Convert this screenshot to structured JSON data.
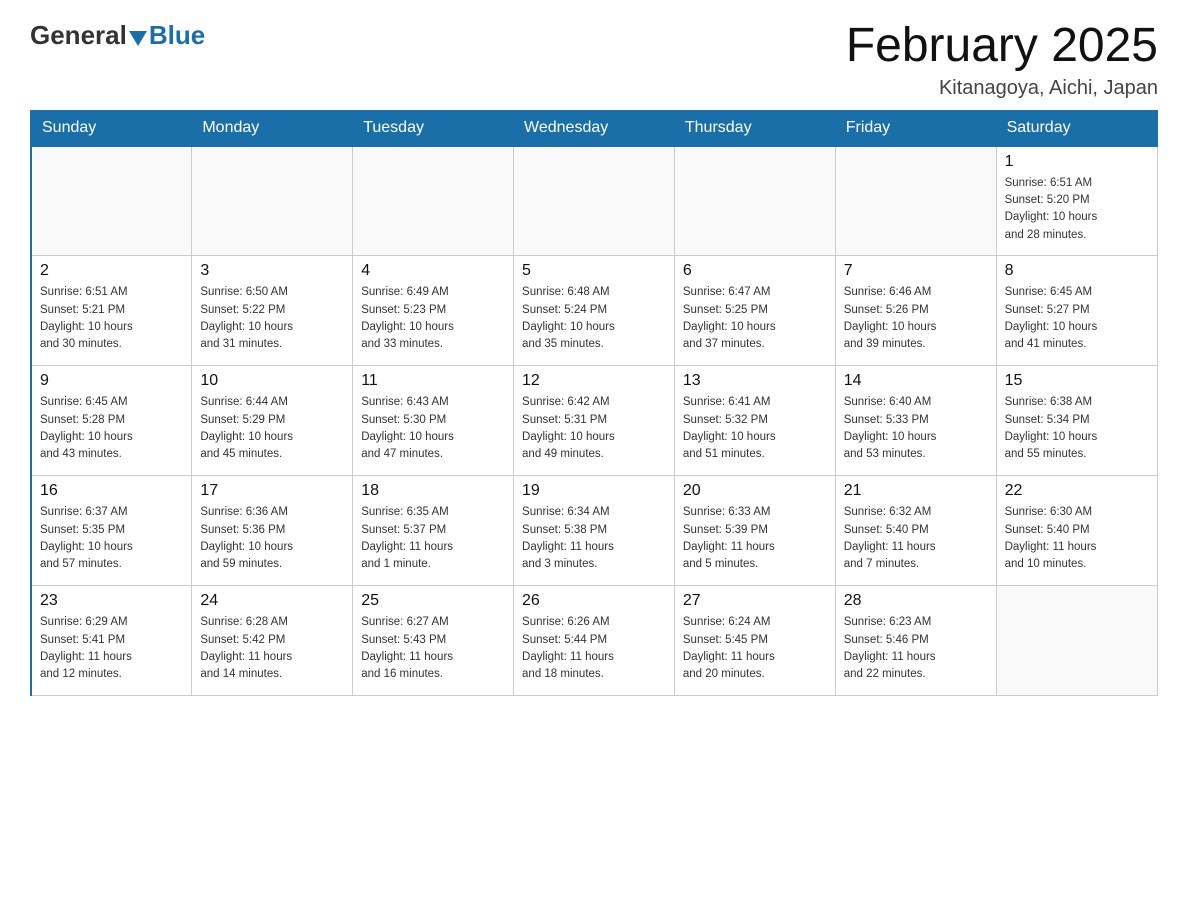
{
  "header": {
    "logo": {
      "general": "General",
      "blue": "Blue"
    },
    "title": "February 2025",
    "location": "Kitanagoya, Aichi, Japan"
  },
  "days_of_week": [
    "Sunday",
    "Monday",
    "Tuesday",
    "Wednesday",
    "Thursday",
    "Friday",
    "Saturday"
  ],
  "weeks": [
    [
      {
        "day": "",
        "info": ""
      },
      {
        "day": "",
        "info": ""
      },
      {
        "day": "",
        "info": ""
      },
      {
        "day": "",
        "info": ""
      },
      {
        "day": "",
        "info": ""
      },
      {
        "day": "",
        "info": ""
      },
      {
        "day": "1",
        "info": "Sunrise: 6:51 AM\nSunset: 5:20 PM\nDaylight: 10 hours\nand 28 minutes."
      }
    ],
    [
      {
        "day": "2",
        "info": "Sunrise: 6:51 AM\nSunset: 5:21 PM\nDaylight: 10 hours\nand 30 minutes."
      },
      {
        "day": "3",
        "info": "Sunrise: 6:50 AM\nSunset: 5:22 PM\nDaylight: 10 hours\nand 31 minutes."
      },
      {
        "day": "4",
        "info": "Sunrise: 6:49 AM\nSunset: 5:23 PM\nDaylight: 10 hours\nand 33 minutes."
      },
      {
        "day": "5",
        "info": "Sunrise: 6:48 AM\nSunset: 5:24 PM\nDaylight: 10 hours\nand 35 minutes."
      },
      {
        "day": "6",
        "info": "Sunrise: 6:47 AM\nSunset: 5:25 PM\nDaylight: 10 hours\nand 37 minutes."
      },
      {
        "day": "7",
        "info": "Sunrise: 6:46 AM\nSunset: 5:26 PM\nDaylight: 10 hours\nand 39 minutes."
      },
      {
        "day": "8",
        "info": "Sunrise: 6:45 AM\nSunset: 5:27 PM\nDaylight: 10 hours\nand 41 minutes."
      }
    ],
    [
      {
        "day": "9",
        "info": "Sunrise: 6:45 AM\nSunset: 5:28 PM\nDaylight: 10 hours\nand 43 minutes."
      },
      {
        "day": "10",
        "info": "Sunrise: 6:44 AM\nSunset: 5:29 PM\nDaylight: 10 hours\nand 45 minutes."
      },
      {
        "day": "11",
        "info": "Sunrise: 6:43 AM\nSunset: 5:30 PM\nDaylight: 10 hours\nand 47 minutes."
      },
      {
        "day": "12",
        "info": "Sunrise: 6:42 AM\nSunset: 5:31 PM\nDaylight: 10 hours\nand 49 minutes."
      },
      {
        "day": "13",
        "info": "Sunrise: 6:41 AM\nSunset: 5:32 PM\nDaylight: 10 hours\nand 51 minutes."
      },
      {
        "day": "14",
        "info": "Sunrise: 6:40 AM\nSunset: 5:33 PM\nDaylight: 10 hours\nand 53 minutes."
      },
      {
        "day": "15",
        "info": "Sunrise: 6:38 AM\nSunset: 5:34 PM\nDaylight: 10 hours\nand 55 minutes."
      }
    ],
    [
      {
        "day": "16",
        "info": "Sunrise: 6:37 AM\nSunset: 5:35 PM\nDaylight: 10 hours\nand 57 minutes."
      },
      {
        "day": "17",
        "info": "Sunrise: 6:36 AM\nSunset: 5:36 PM\nDaylight: 10 hours\nand 59 minutes."
      },
      {
        "day": "18",
        "info": "Sunrise: 6:35 AM\nSunset: 5:37 PM\nDaylight: 11 hours\nand 1 minute."
      },
      {
        "day": "19",
        "info": "Sunrise: 6:34 AM\nSunset: 5:38 PM\nDaylight: 11 hours\nand 3 minutes."
      },
      {
        "day": "20",
        "info": "Sunrise: 6:33 AM\nSunset: 5:39 PM\nDaylight: 11 hours\nand 5 minutes."
      },
      {
        "day": "21",
        "info": "Sunrise: 6:32 AM\nSunset: 5:40 PM\nDaylight: 11 hours\nand 7 minutes."
      },
      {
        "day": "22",
        "info": "Sunrise: 6:30 AM\nSunset: 5:40 PM\nDaylight: 11 hours\nand 10 minutes."
      }
    ],
    [
      {
        "day": "23",
        "info": "Sunrise: 6:29 AM\nSunset: 5:41 PM\nDaylight: 11 hours\nand 12 minutes."
      },
      {
        "day": "24",
        "info": "Sunrise: 6:28 AM\nSunset: 5:42 PM\nDaylight: 11 hours\nand 14 minutes."
      },
      {
        "day": "25",
        "info": "Sunrise: 6:27 AM\nSunset: 5:43 PM\nDaylight: 11 hours\nand 16 minutes."
      },
      {
        "day": "26",
        "info": "Sunrise: 6:26 AM\nSunset: 5:44 PM\nDaylight: 11 hours\nand 18 minutes."
      },
      {
        "day": "27",
        "info": "Sunrise: 6:24 AM\nSunset: 5:45 PM\nDaylight: 11 hours\nand 20 minutes."
      },
      {
        "day": "28",
        "info": "Sunrise: 6:23 AM\nSunset: 5:46 PM\nDaylight: 11 hours\nand 22 minutes."
      },
      {
        "day": "",
        "info": ""
      }
    ]
  ]
}
